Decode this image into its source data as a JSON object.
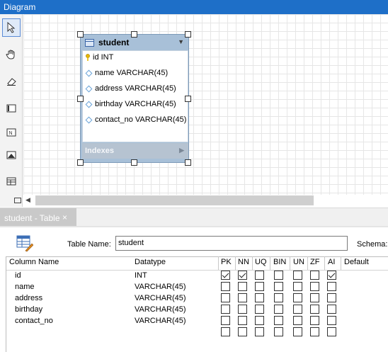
{
  "diagram": {
    "header_title": "Diagram",
    "tools": [
      "pointer-icon",
      "hand-icon",
      "eraser-icon",
      "layer-icon",
      "note-icon",
      "image-icon",
      "table-icon"
    ]
  },
  "entity": {
    "title": "student",
    "columns": [
      {
        "text": "id INT",
        "key": true
      },
      {
        "text": "name VARCHAR(45)",
        "key": false
      },
      {
        "text": "address VARCHAR(45)",
        "key": false
      },
      {
        "text": "birthday VARCHAR(45)",
        "key": false
      },
      {
        "text": "contact_no VARCHAR(45)",
        "key": false
      }
    ],
    "indexes_label": "Indexes"
  },
  "tab": {
    "label": "student - Table",
    "close": "×"
  },
  "editor": {
    "table_name_label": "Table Name:",
    "table_name_value": "student",
    "schema_label": "Schema:"
  },
  "grid": {
    "headers": {
      "column_name": "Column Name",
      "datatype": "Datatype",
      "pk": "PK",
      "nn": "NN",
      "uq": "UQ",
      "bin": "BIN",
      "un": "UN",
      "zf": "ZF",
      "ai": "AI",
      "default": "Default"
    },
    "rows": [
      {
        "name": "id",
        "type": "INT",
        "pk": true,
        "nn": true,
        "uq": false,
        "bin": false,
        "un": false,
        "zf": false,
        "ai": true
      },
      {
        "name": "name",
        "type": "VARCHAR(45)",
        "pk": false,
        "nn": false,
        "uq": false,
        "bin": false,
        "un": false,
        "zf": false,
        "ai": false
      },
      {
        "name": "address",
        "type": "VARCHAR(45)",
        "pk": false,
        "nn": false,
        "uq": false,
        "bin": false,
        "un": false,
        "zf": false,
        "ai": false
      },
      {
        "name": "birthday",
        "type": "VARCHAR(45)",
        "pk": false,
        "nn": false,
        "uq": false,
        "bin": false,
        "un": false,
        "zf": false,
        "ai": false
      },
      {
        "name": "contact_no",
        "type": "VARCHAR(45)",
        "pk": false,
        "nn": false,
        "uq": false,
        "bin": false,
        "un": false,
        "zf": false,
        "ai": false
      },
      {
        "name": "",
        "type": "",
        "pk": false,
        "nn": false,
        "uq": false,
        "bin": false,
        "un": false,
        "zf": false,
        "ai": false
      }
    ]
  },
  "colors": {
    "header_blue": "#1e6fc8",
    "entity_blue": "#a8c0d8"
  }
}
